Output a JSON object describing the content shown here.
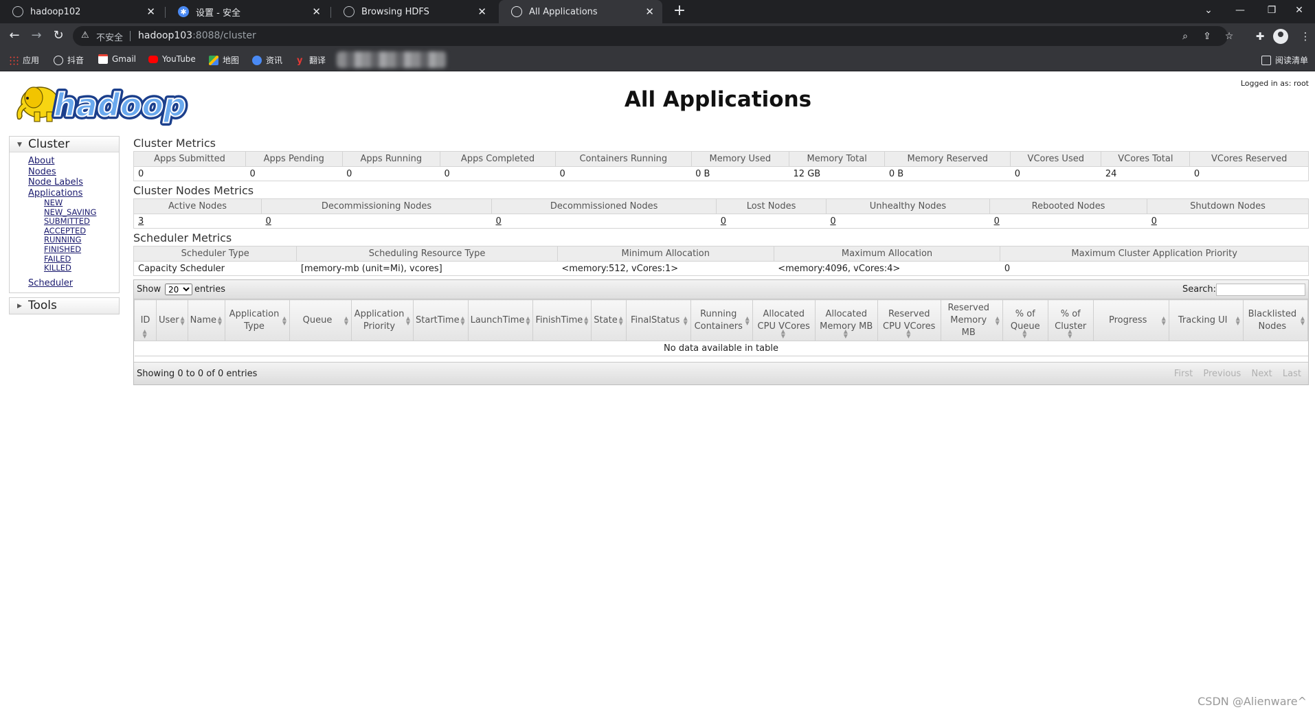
{
  "browser": {
    "tabs": [
      {
        "title": "hadoop102",
        "icon": "globe-icon"
      },
      {
        "title": "设置 - 安全",
        "icon": "settings-gear-icon"
      },
      {
        "title": "Browsing HDFS",
        "icon": "globe-icon"
      },
      {
        "title": "All Applications",
        "icon": "globe-icon"
      }
    ],
    "active_tab": 3,
    "address": {
      "security_label": "不安全",
      "host": "hadoop103",
      "path": ":8088/cluster"
    },
    "bookmarks": [
      {
        "label": "应用",
        "icon": "apps-grid-icon"
      },
      {
        "label": "抖音",
        "icon": "globe-icon"
      },
      {
        "label": "Gmail",
        "icon": "gmail-icon"
      },
      {
        "label": "YouTube",
        "icon": "youtube-icon"
      },
      {
        "label": "地图",
        "icon": "maps-icon"
      },
      {
        "label": "资讯",
        "icon": "news-icon"
      },
      {
        "label": "翻译",
        "icon": "youdao-icon"
      }
    ],
    "reading_list": "阅读清单"
  },
  "header": {
    "logged_in": "Logged in as: root",
    "title": "All Applications",
    "logo_text": "hadoop"
  },
  "nav": {
    "cluster_label": "Cluster",
    "links": [
      "About",
      "Nodes",
      "Node Labels",
      "Applications"
    ],
    "app_states": [
      "NEW",
      "NEW_SAVING",
      "SUBMITTED",
      "ACCEPTED",
      "RUNNING",
      "FINISHED",
      "FAILED",
      "KILLED"
    ],
    "scheduler": "Scheduler",
    "tools_label": "Tools"
  },
  "cluster_metrics": {
    "title": "Cluster Metrics",
    "headers": [
      "Apps Submitted",
      "Apps Pending",
      "Apps Running",
      "Apps Completed",
      "Containers Running",
      "Memory Used",
      "Memory Total",
      "Memory Reserved",
      "VCores Used",
      "VCores Total",
      "VCores Reserved"
    ],
    "values": [
      "0",
      "0",
      "0",
      "0",
      "0",
      "0 B",
      "12 GB",
      "0 B",
      "0",
      "24",
      "0"
    ]
  },
  "node_metrics": {
    "title": "Cluster Nodes Metrics",
    "headers": [
      "Active Nodes",
      "Decommissioning Nodes",
      "Decommissioned Nodes",
      "Lost Nodes",
      "Unhealthy Nodes",
      "Rebooted Nodes",
      "Shutdown Nodes"
    ],
    "values": [
      "3",
      "0",
      "0",
      "0",
      "0",
      "0",
      "0"
    ]
  },
  "scheduler_metrics": {
    "title": "Scheduler Metrics",
    "headers": [
      "Scheduler Type",
      "Scheduling Resource Type",
      "Minimum Allocation",
      "Maximum Allocation",
      "Maximum Cluster Application Priority"
    ],
    "values": [
      "Capacity Scheduler",
      "[memory-mb (unit=Mi), vcores]",
      "<memory:512, vCores:1>",
      "<memory:4096, vCores:4>",
      "0"
    ]
  },
  "apps_table": {
    "show_label": "Show",
    "page_size": "20",
    "entries_label": "entries",
    "search_label": "Search:",
    "columns": [
      "ID",
      "User",
      "Name",
      "Application Type",
      "Queue",
      "Application Priority",
      "StartTime",
      "LaunchTime",
      "FinishTime",
      "State",
      "FinalStatus",
      "Running Containers",
      "Allocated CPU VCores",
      "Allocated Memory MB",
      "Reserved CPU VCores",
      "Reserved Memory MB",
      "% of Queue",
      "% of Cluster",
      "Progress",
      "Tracking UI",
      "Blacklisted Nodes"
    ],
    "empty_message": "No data available in table",
    "info": "Showing 0 to 0 of 0 entries",
    "pager": [
      "First",
      "Previous",
      "Next",
      "Last"
    ]
  },
  "watermark": "CSDN @Alienware^"
}
